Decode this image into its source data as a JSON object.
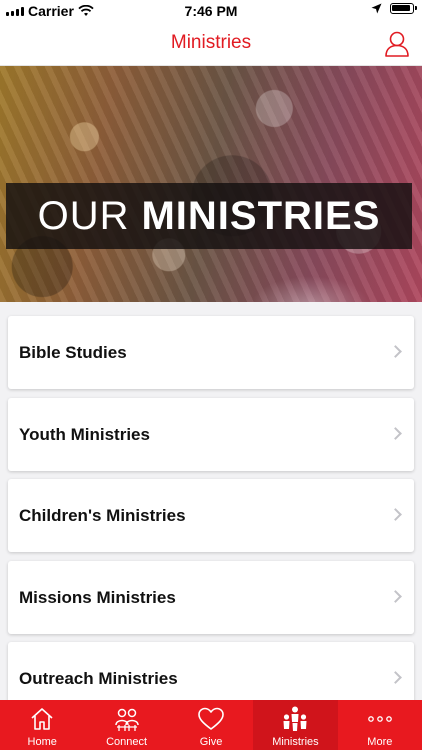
{
  "status": {
    "carrier": "Carrier",
    "time": "7:46 PM"
  },
  "nav": {
    "title": "Ministries",
    "user_icon": "user-icon"
  },
  "hero": {
    "word1": "OUR",
    "word2": "MINISTRIES"
  },
  "ministries": [
    {
      "label": "Bible Studies"
    },
    {
      "label": "Youth Ministries"
    },
    {
      "label": "Children's Ministries"
    },
    {
      "label": "Missions Ministries"
    },
    {
      "label": "Outreach Ministries"
    }
  ],
  "tabs": [
    {
      "label": "Home",
      "icon": "home-icon"
    },
    {
      "label": "Connect",
      "icon": "people-icon"
    },
    {
      "label": "Give",
      "icon": "heart-icon"
    },
    {
      "label": "Ministries",
      "icon": "family-icon",
      "active": true
    },
    {
      "label": "More",
      "icon": "more-icon"
    }
  ],
  "colors": {
    "accent": "#e11b22",
    "tab_bar": "#e8191f"
  }
}
